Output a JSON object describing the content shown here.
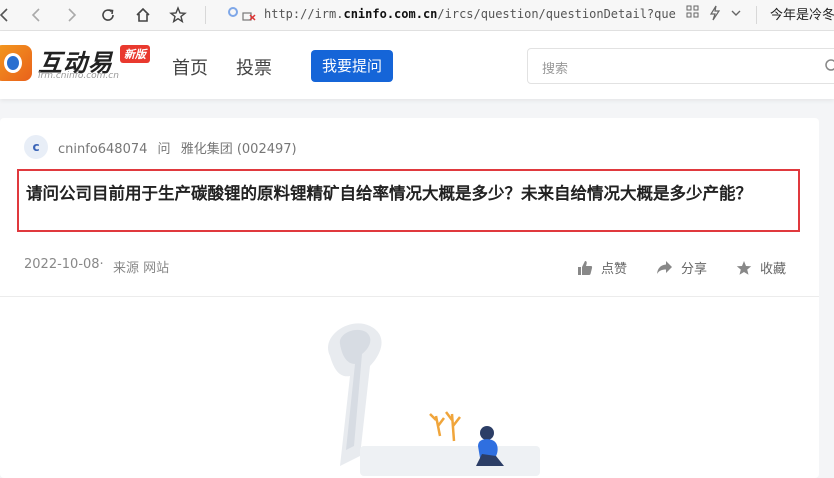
{
  "browser": {
    "url_prefix": "http://irm.",
    "url_domain": "cninfo.com.cn",
    "url_path": "/ircs/question/questionDetail?que",
    "right_text": "今年是冷冬",
    "icons": [
      "back-icon",
      "forward-icon",
      "reload-icon",
      "home-icon",
      "star-icon",
      "grid-icon",
      "lightning-icon",
      "chevron-down-icon"
    ]
  },
  "header": {
    "logo_name": "互动易",
    "logo_badge": "新版",
    "logo_sub": "irm.cninfo.com.cn",
    "nav": [
      "首页",
      "投票"
    ],
    "ask_button": "我要提问",
    "search_placeholder": "搜索"
  },
  "question": {
    "avatar_letter": "c",
    "user": "cninfo648074",
    "ask_word": "问",
    "company": "雅化集团 (002497)",
    "text": "请问公司目前用于生产碳酸锂的原料锂精矿自给率情况大概是多少？未来自给情况大概是多少产能？",
    "date": "2022-10-08·",
    "source": "来源 网站",
    "actions": {
      "like": "点赞",
      "share": "分享",
      "favorite": "收藏"
    }
  },
  "colors": {
    "accent": "#1565d8",
    "highlight": "#e0393e"
  }
}
